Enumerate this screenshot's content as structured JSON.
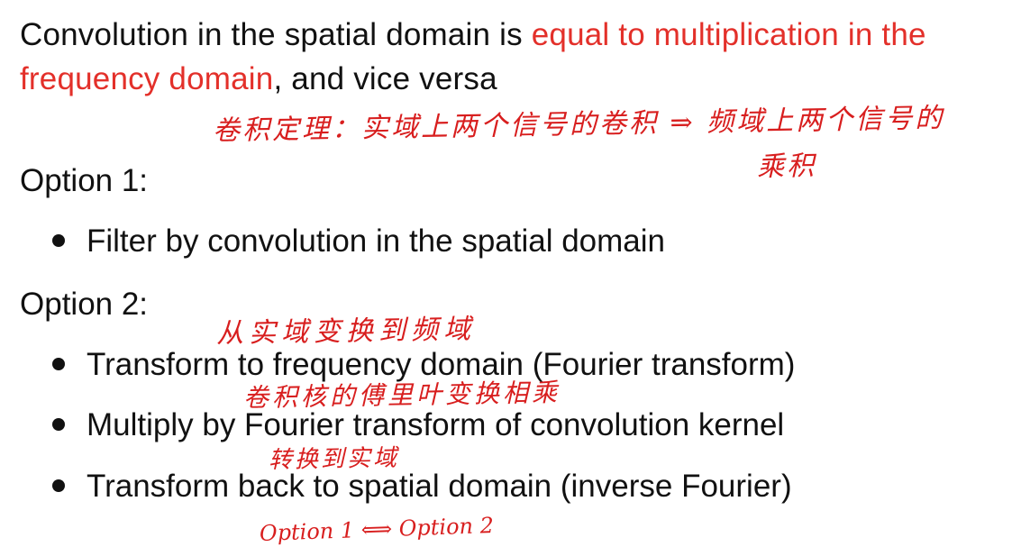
{
  "intro": {
    "part1": "Convolution in the spatial domain is ",
    "highlight": "equal to multiplication in the frequency domain",
    "part2": ", and vice versa"
  },
  "option1": {
    "heading": "Option 1:",
    "bullets": [
      "Filter by convolution in the spatial domain"
    ]
  },
  "option2": {
    "heading": "Option 2:",
    "bullets": [
      "Transform to frequency domain (Fourier transform)",
      "Multiply by Fourier transform of convolution kernel",
      "Transform back to spatial domain (inverse Fourier)"
    ]
  },
  "annotations": {
    "convolution_theorem_line1": "卷积定理：实域上两个信号的卷积 ⇒ 频域上两个信号的",
    "convolution_theorem_line2": "乘积",
    "to_freq": "从实域变换到频域",
    "kernel_multiply": "卷积核的傅里叶变换相乘",
    "to_spatial": "转换到实域",
    "equivalence": "Option 1 ⟺ Option 2"
  },
  "colors": {
    "text": "#111111",
    "highlight": "#e3302a",
    "handwriting": "#d81e1e"
  }
}
